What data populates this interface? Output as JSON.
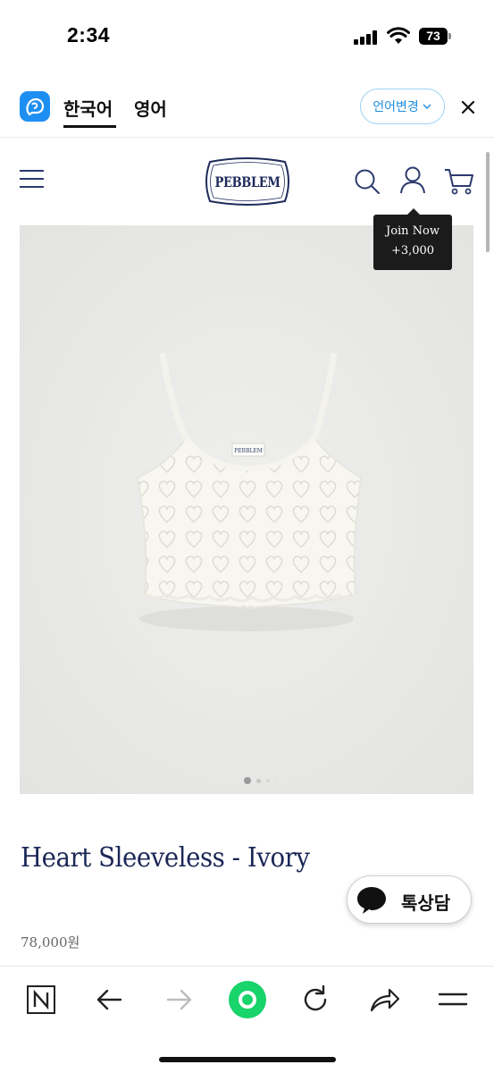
{
  "status_bar": {
    "time": "2:34",
    "battery": "73"
  },
  "translate_bar": {
    "language_active": "한국어",
    "language_other": "영어",
    "change_language_label": "언어변경",
    "accent_color": "#1e8ff2"
  },
  "shop_header": {
    "brand": "PEBBLEM",
    "icons": [
      "menu-icon",
      "search-icon",
      "user-icon",
      "cart-icon"
    ]
  },
  "tooltip": {
    "line1": "Join Now",
    "line2": "+3,000"
  },
  "product": {
    "carousel": {
      "current_slide": 1,
      "slides": 4
    },
    "name": "Heart Sleeveless - Ivory",
    "price": "78,000원",
    "talk_label": "톡상담"
  },
  "bottom_nav": {
    "items": [
      "naver-n-icon",
      "back-icon",
      "forward-icon",
      "green-home-icon",
      "reload-icon",
      "share-icon",
      "menu-lines-icon"
    ]
  },
  "colors": {
    "brand_navy": "#1f2b5c",
    "naver_green": "#19d36b",
    "tooltip_bg": "#1b1b1b"
  }
}
